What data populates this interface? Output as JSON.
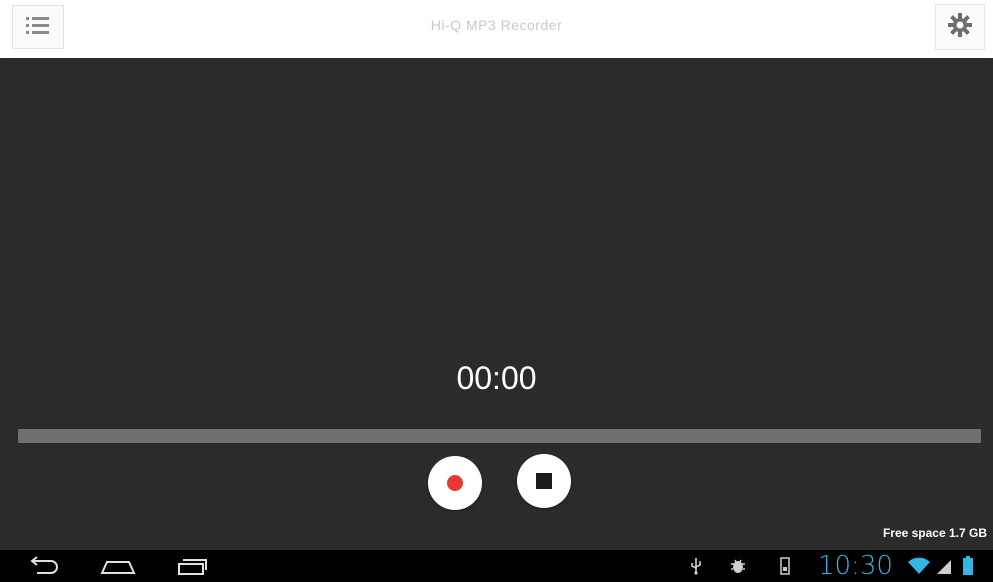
{
  "topbar": {
    "title": "Hi-Q MP3 Recorder",
    "menu_icon": "list-icon",
    "settings_icon": "gear-icon"
  },
  "recorder": {
    "elapsed_time": "00:00",
    "progress": 0,
    "record_icon": "record-icon",
    "stop_icon": "stop-icon",
    "free_space": "Free space 1.7 GB"
  },
  "system_bar": {
    "nav": [
      "back-icon",
      "home-icon",
      "recent-apps-icon"
    ],
    "status_icons": [
      "usb-icon",
      "debug-icon",
      "sd-card-icon",
      "wifi-icon",
      "signal-icon",
      "battery-icon"
    ],
    "clock": "10:30"
  },
  "colors": {
    "background": "#2a2a2a",
    "record_red": "#e53935",
    "clock_blue": "#33b5e5",
    "topbar": "#ffffff"
  }
}
